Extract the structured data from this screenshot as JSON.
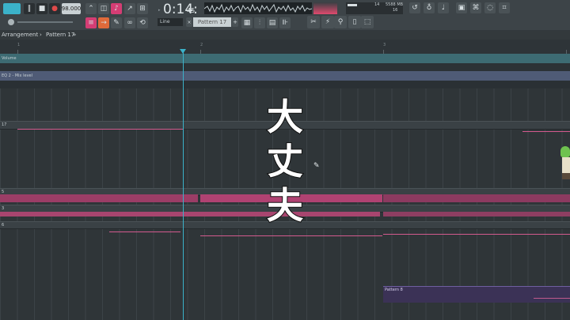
{
  "toolbar": {
    "tempo": "98.000",
    "time": "0:14:",
    "time_small": "45",
    "mode": "Line",
    "pattern": "Pattern 17",
    "cpu_value": "14",
    "memory": "5588 MB",
    "voices": "16"
  },
  "breadcrumb": {
    "arrangement": "Arrangement",
    "sep": "›",
    "pattern": "Pattern 17",
    "pin": "»"
  },
  "ruler": {
    "numbers": [
      "1",
      "2",
      "3"
    ]
  },
  "lanes": {
    "volume_label": "Volume",
    "mix_label": "EQ 2 - Mix level"
  },
  "tracks": {
    "t17": "17",
    "t5": "5",
    "t3": "3",
    "t6": "6"
  },
  "overlay": {
    "chars": [
      "大",
      "丈",
      "夫"
    ]
  },
  "pattern8": {
    "label": "Pattern 8"
  },
  "colors": {
    "accent_cyan": "#3bb2c9",
    "clip_pink": "#c04b7e",
    "pattern_purple": "#3b3256",
    "record_red": "#e04a4a"
  }
}
